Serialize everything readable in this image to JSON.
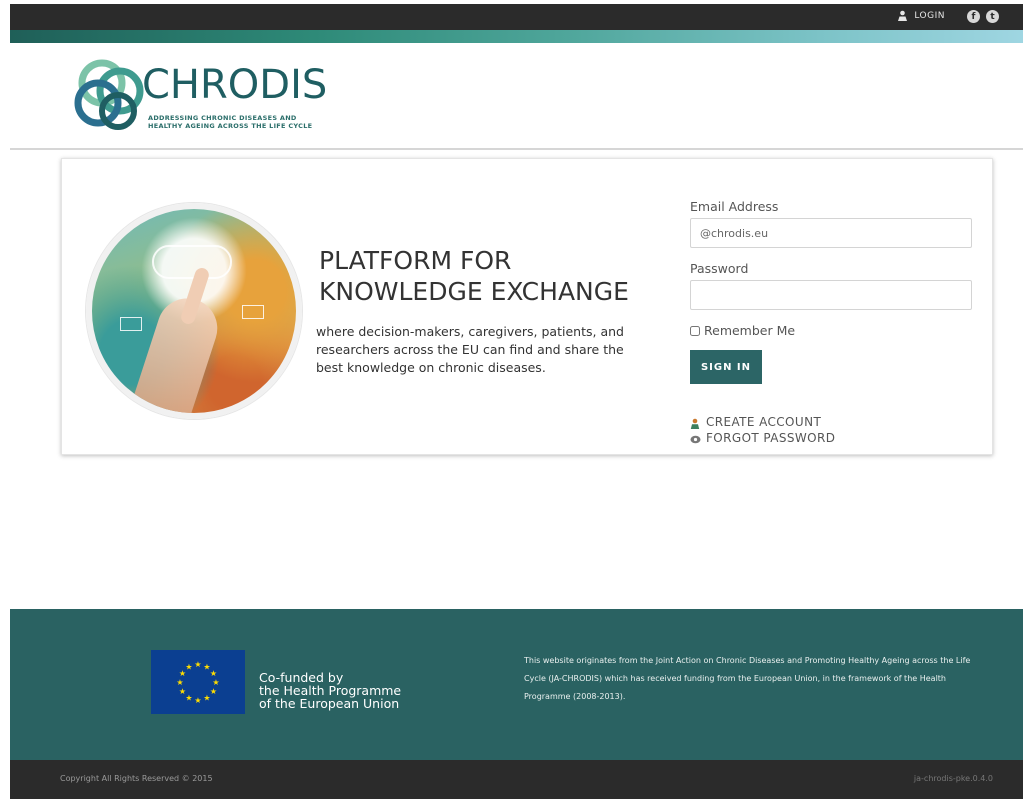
{
  "topbar": {
    "login_label": "LOGIN",
    "login_icon": "user-icon",
    "social": [
      {
        "name": "facebook-icon",
        "glyph": "f"
      },
      {
        "name": "twitter-icon",
        "glyph": "t"
      }
    ]
  },
  "logo": {
    "name": "CHRODIS",
    "tagline_line1": "ADDRESSING CHRONIC DISEASES AND",
    "tagline_line2": "HEALTHY AGEING ACROSS THE LIFE CYCLE"
  },
  "hero": {
    "headline_line1": "PLATFORM FOR",
    "headline_line2": "KNOWLEDGE EXCHANGE",
    "description": "where decision-makers, caregivers, patients, and researchers across the EU can find and share the best knowledge on chronic diseases."
  },
  "login_form": {
    "email_label": "Email Address",
    "email_value": "@chrodis.eu",
    "password_label": "Password",
    "password_value": "",
    "remember_label": "Remember Me",
    "remember_checked": false,
    "signin_label": "SIGN IN",
    "create_account_label": "CREATE ACCOUNT",
    "create_account_icon": "user-add-icon",
    "forgot_password_label": "FORGOT PASSWORD",
    "forgot_password_icon": "key-icon"
  },
  "footer": {
    "cofunded_line1": "Co-funded by",
    "cofunded_line2": "the Health Programme",
    "cofunded_line3": "of the European Union",
    "description": "This website originates from the Joint Action on Chronic Diseases and Promoting Healthy Ageing across the Life Cycle (JA-CHRODIS) which has received funding from the European Union, in the framework of the Health Programme (2008-2013).",
    "copyright": "Copyright All Rights Reserved © 2015",
    "version": "ja-chrodis-pke.0.4.0"
  },
  "colors": {
    "brand_teal": "#2c6566",
    "footer_bg": "#2a6262",
    "topbar_bg": "#2b2b2b",
    "eu_blue": "#0b3f91",
    "eu_star": "#ffdd00"
  }
}
